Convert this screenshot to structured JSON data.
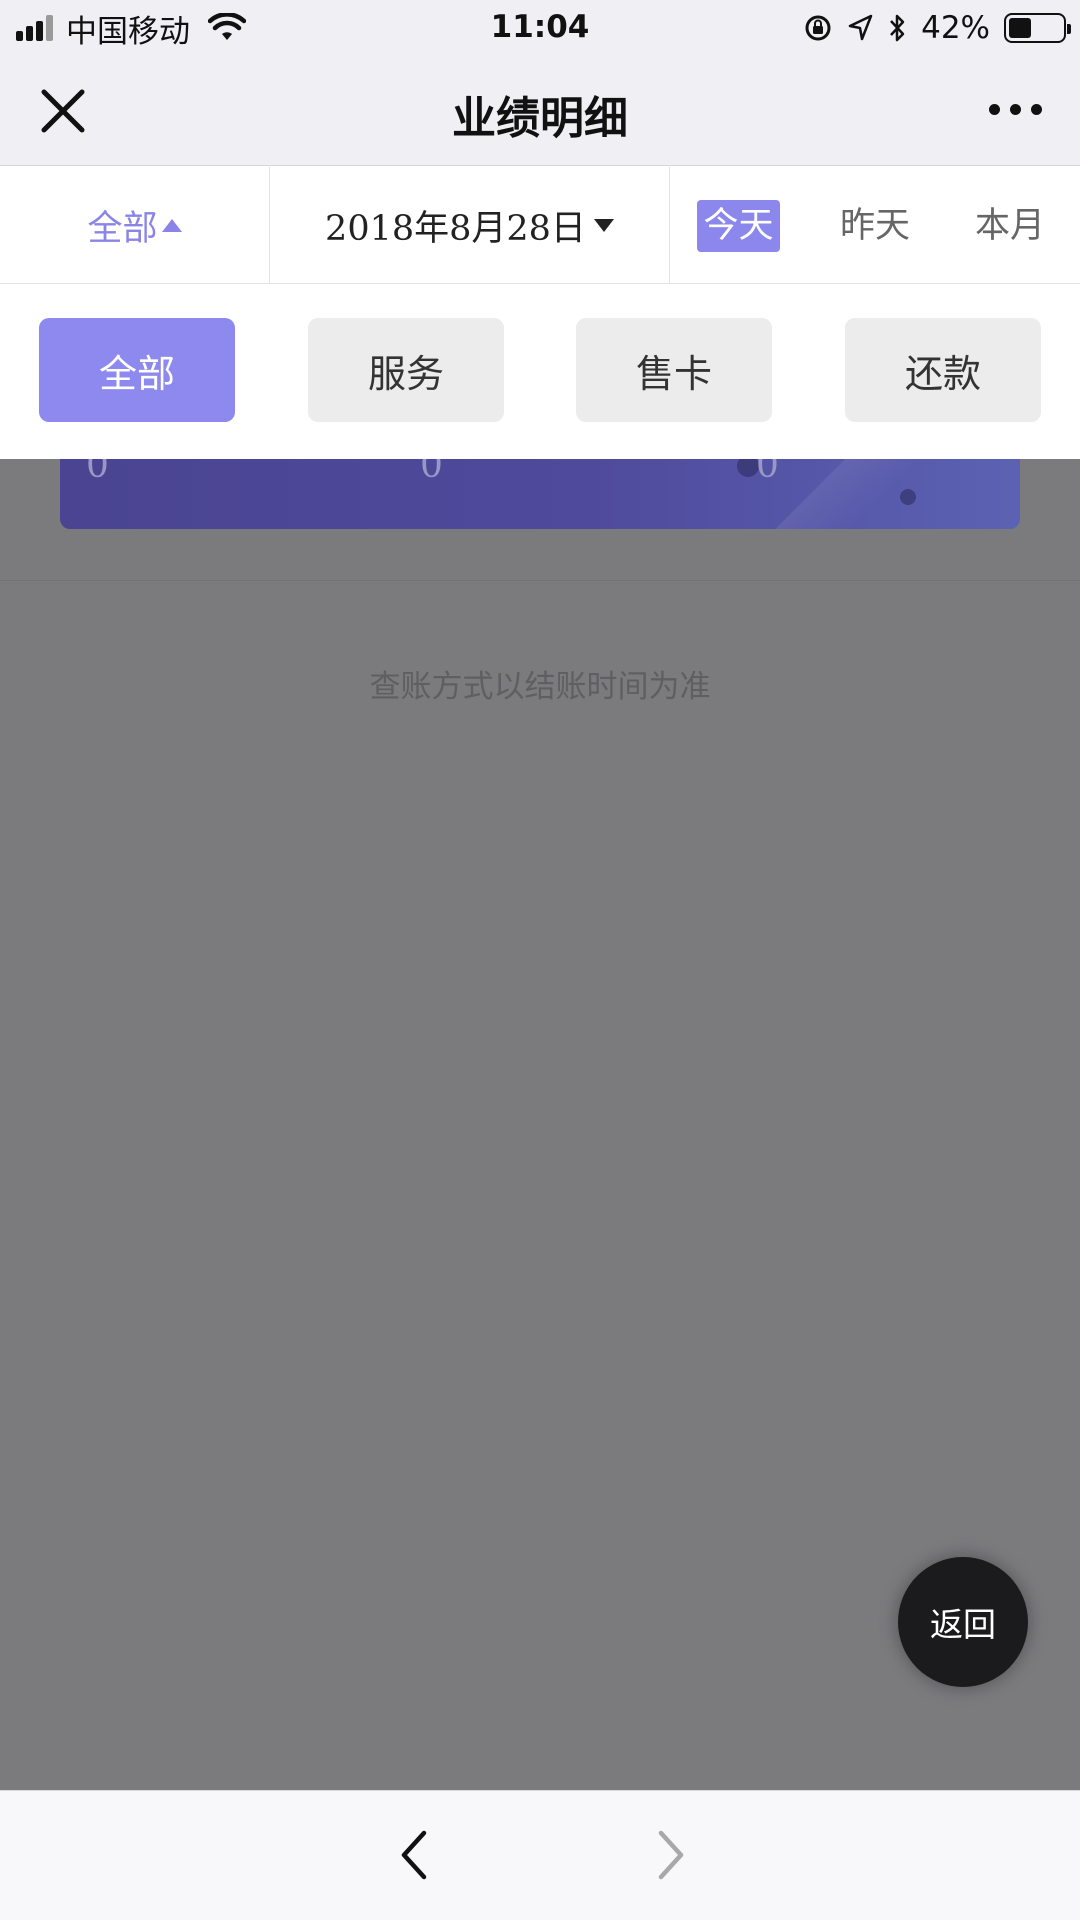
{
  "status_bar": {
    "carrier": "中国移动",
    "time": "11:04",
    "battery_percent": "42%",
    "battery_level": 0.42,
    "icons": [
      "signal-icon",
      "wifi-icon",
      "rotation-lock-icon",
      "location-icon",
      "bluetooth-icon",
      "battery-icon"
    ]
  },
  "nav": {
    "title": "业绩明细",
    "icons": [
      "close-icon",
      "more-icon"
    ]
  },
  "filter": {
    "scope_label": "全部",
    "date_label": "2018年8月28日",
    "quick_ranges": [
      "今天",
      "昨天",
      "本月"
    ],
    "selected_quick_range": "今天"
  },
  "categories": {
    "items": [
      "全部",
      "服务",
      "售卡",
      "还款"
    ],
    "selected": "全部"
  },
  "summary_card": {
    "values": [
      "0",
      "0",
      "0"
    ]
  },
  "note": "查账方式以结账时间为准",
  "fab": {
    "label": "返回"
  },
  "toolbar": {
    "icons": [
      "back-arrow-icon",
      "forward-arrow-icon"
    ]
  },
  "colors": {
    "accent": "#8e89ef",
    "overlay": "#7b7b7e",
    "card": "#4f4a9c",
    "fab": "#1b1b1d"
  }
}
